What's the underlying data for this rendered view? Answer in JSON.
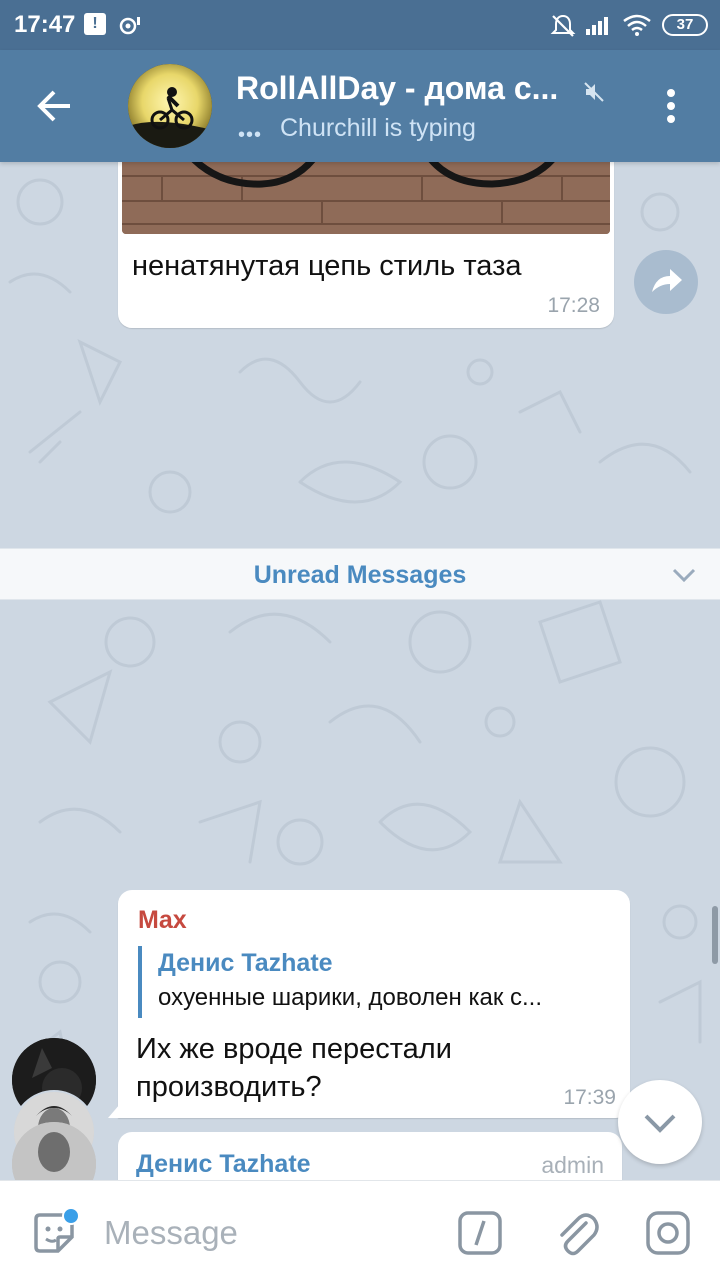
{
  "status_bar": {
    "time": "17:47",
    "battery": "37",
    "notif_badge": "!"
  },
  "header": {
    "title": "RollAllDay - дома с...",
    "typing_dots": "•••",
    "subtitle": "Churchill is typing"
  },
  "messages": [
    {
      "text": "ненатянутая цепь стиль таза",
      "time": "17:28"
    },
    {
      "sender": "Max",
      "reply_to_name": "Денис Tazhate",
      "reply_to_text": "охуенные шарики, доволен как с...",
      "text": "Их же вроде перестали производить?",
      "time": "17:39"
    },
    {
      "sender": "Денис Tazhate",
      "badge": "admin"
    }
  ],
  "unread_label": "Unread Messages",
  "input": {
    "placeholder": "Message"
  },
  "colors": {
    "header": "#527da3",
    "status_bar": "#4a6f93",
    "chat_bg": "#cdd7e2",
    "accent": "#4a8ac0",
    "sender_max": "#c6493f"
  }
}
